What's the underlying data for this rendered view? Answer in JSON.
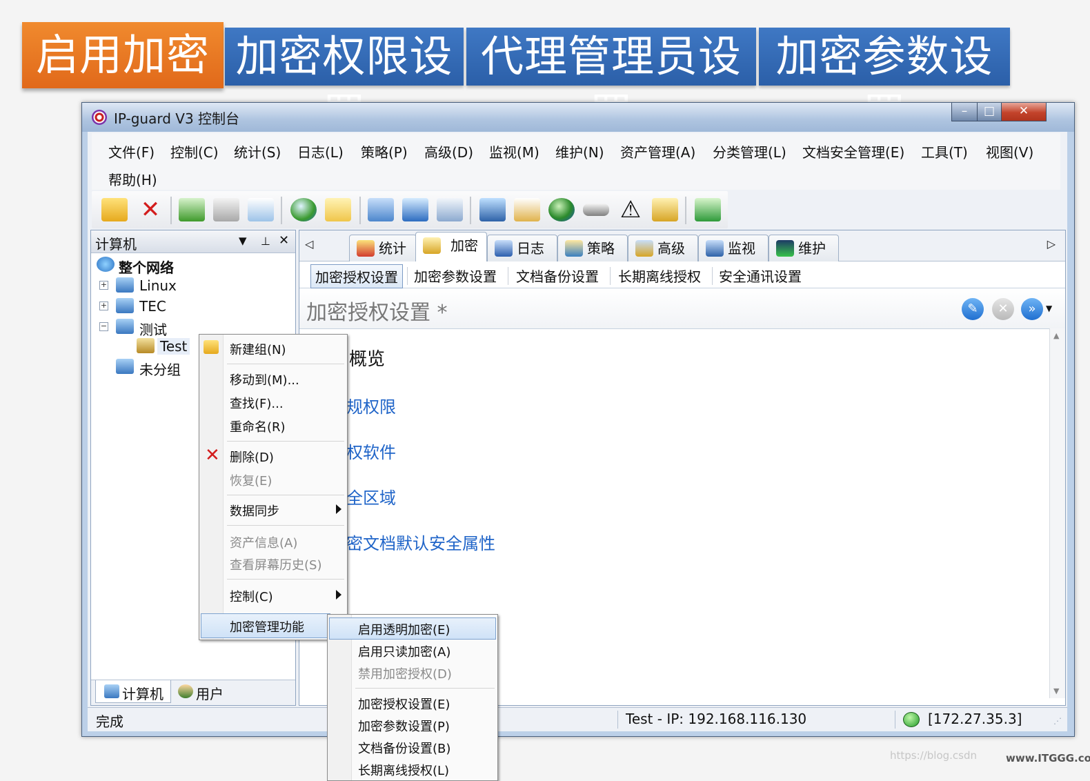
{
  "banner": {
    "tabs": [
      "启用加密",
      "加密权限设置",
      "代理管理员设置",
      "加密参数设置"
    ]
  },
  "window": {
    "title": "IP-guard V3 控制台",
    "buttons": {
      "minimize": "–",
      "maximize": "□",
      "close": "✕"
    }
  },
  "menubar": {
    "items": [
      "文件(F)",
      "控制(C)",
      "统计(S)",
      "日志(L)",
      "策略(P)",
      "高级(D)",
      "监视(M)",
      "维护(N)",
      "资产管理(A)",
      "分类管理(L)",
      "文档安全管理(E)",
      "工具(T)",
      "视图(V)",
      "帮助(H)"
    ]
  },
  "toolbar": {
    "icons": [
      "new-group-icon",
      "delete-icon",
      "import-icon",
      "print-icon",
      "print-preview-icon",
      "globe-icon",
      "note-icon",
      "copy-icon",
      "search-icon",
      "export-icon",
      "computer-icon",
      "report-icon",
      "network-icon",
      "disk-icon",
      "warning-icon",
      "lock-icon",
      "refresh-icon"
    ]
  },
  "leftpane": {
    "title": "计算机",
    "controls": {
      "dropdown": "▼",
      "pin": "ᵖ",
      "close": "✕"
    },
    "tree": {
      "root": "整个网络",
      "items": [
        "Linux",
        "TEC",
        "测试",
        "Test",
        "未分组"
      ]
    },
    "bottom_tabs": [
      "计算机",
      "用户"
    ]
  },
  "rightpane": {
    "tabs": [
      "统计",
      "加密",
      "日志",
      "策略",
      "高级",
      "监视",
      "维护"
    ],
    "active_tab": "加密",
    "subtabs": [
      "加密授权设置",
      "加密参数设置",
      "文档备份设置",
      "长期离线授权",
      "安全通讯设置"
    ],
    "section_title": "加密授权设置 *",
    "content": {
      "overview": "概览",
      "links": [
        "规权限",
        "权软件",
        "全区域",
        "密文档默认安全属性"
      ]
    }
  },
  "statusbar": {
    "left": "完成",
    "host": "Test - IP: 192.168.116.130",
    "server": "[172.27.35.3]"
  },
  "context_menu": {
    "items": [
      {
        "label": "新建组(N)",
        "disabled": false
      },
      {
        "label": "移动到(M)...",
        "disabled": false
      },
      {
        "label": "查找(F)...",
        "disabled": false
      },
      {
        "label": "重命名(R)",
        "disabled": false
      },
      {
        "label": "删除(D)",
        "disabled": false
      },
      {
        "label": "恢复(E)",
        "disabled": true
      },
      {
        "label": "数据同步",
        "disabled": false
      },
      {
        "label": "资产信息(A)",
        "disabled": true
      },
      {
        "label": "查看屏幕历史(S)",
        "disabled": true
      },
      {
        "label": "控制(C)",
        "disabled": false
      },
      {
        "label": "加密管理功能",
        "disabled": false
      }
    ]
  },
  "submenu": {
    "items": [
      {
        "label": "启用透明加密(E)",
        "disabled": false
      },
      {
        "label": "启用只读加密(A)",
        "disabled": false
      },
      {
        "label": "禁用加密授权(D)",
        "disabled": true
      },
      {
        "label": "加密授权设置(E)",
        "disabled": false
      },
      {
        "label": "加密参数设置(P)",
        "disabled": false
      },
      {
        "label": "文档备份设置(B)",
        "disabled": false
      },
      {
        "label": "长期离线授权(L)",
        "disabled": false
      }
    ]
  },
  "watermark": {
    "blog": "https://blog.csdn",
    "site": "www.ITGGG.com"
  },
  "colors": {
    "banner_blue": "#2f68b6",
    "banner_orange": "#e8761f",
    "link_blue": "#1f64c8"
  }
}
